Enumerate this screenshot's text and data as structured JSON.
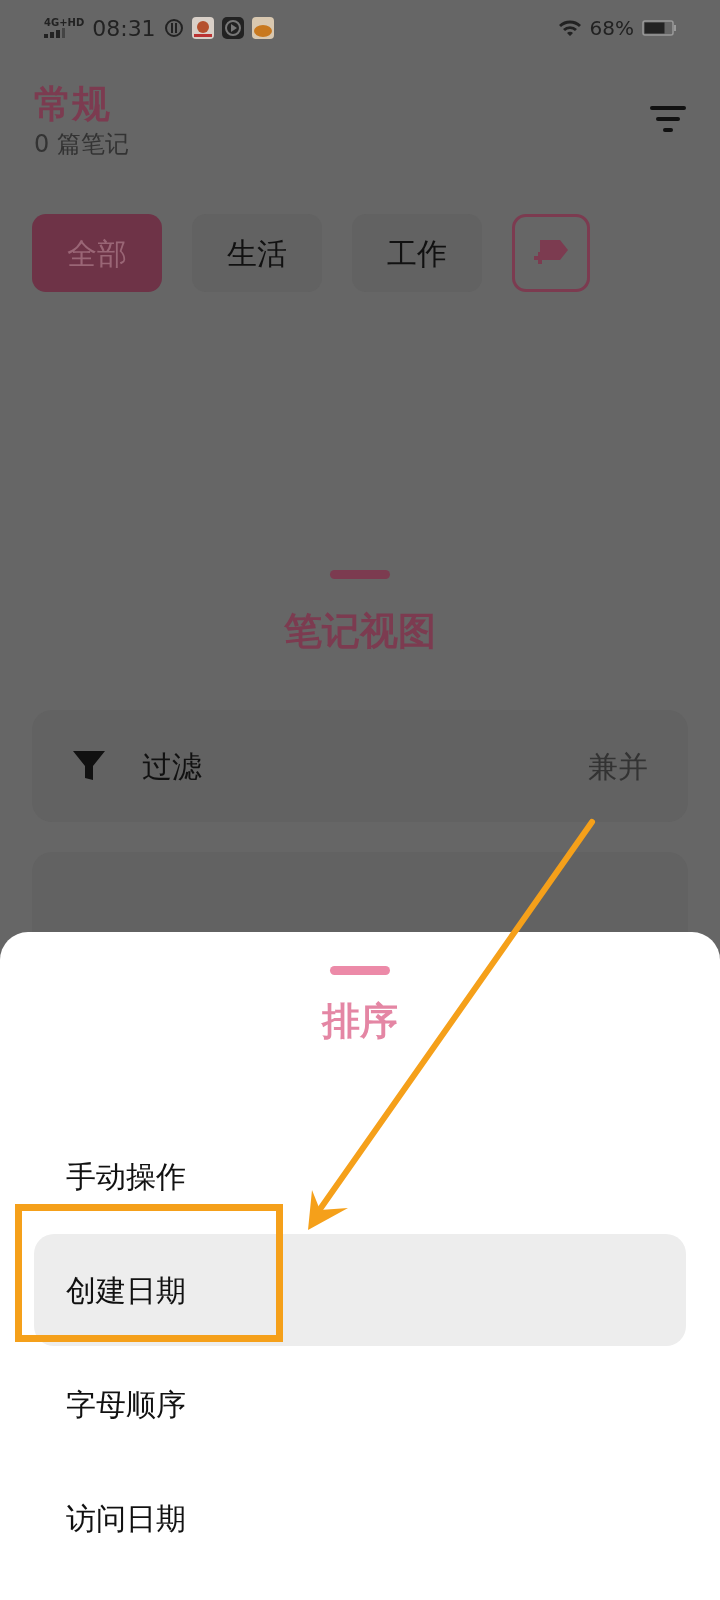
{
  "status_bar": {
    "network": "4G+HD",
    "time": "08:31",
    "battery": "68%"
  },
  "header": {
    "title": "常规",
    "subtitle": "0 篇笔记"
  },
  "tags": [
    {
      "label": "全部",
      "selected": true
    },
    {
      "label": "生活",
      "selected": false
    },
    {
      "label": "工作",
      "selected": false
    }
  ],
  "view_sheet": {
    "title": "笔记视图",
    "rows": [
      {
        "label": "过滤",
        "value": "兼并"
      }
    ]
  },
  "sort_sheet": {
    "title": "排序",
    "options": [
      {
        "label": "手动操作",
        "selected": false
      },
      {
        "label": "创建日期",
        "selected": true
      },
      {
        "label": "字母顺序",
        "selected": false
      },
      {
        "label": "访问日期",
        "selected": false
      }
    ]
  }
}
